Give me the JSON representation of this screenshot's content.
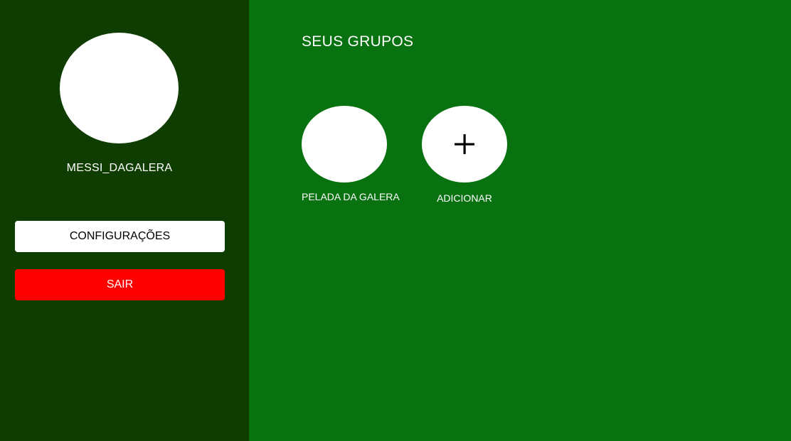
{
  "sidebar": {
    "username": "MESSI_DAGALERA",
    "settings_label": "CONFIGURAÇÕES",
    "exit_label": "SAIR"
  },
  "main": {
    "title": "SEUS GRUPOS",
    "groups": [
      {
        "label": "PELADA DA GALERA"
      }
    ],
    "add_label": "ADICIONAR",
    "add_icon": "plus-icon"
  },
  "colors": {
    "sidebar_bg": "#0f3d00",
    "main_bg": "#087210",
    "exit_button": "#ff0000",
    "settings_button": "#ffffff"
  }
}
